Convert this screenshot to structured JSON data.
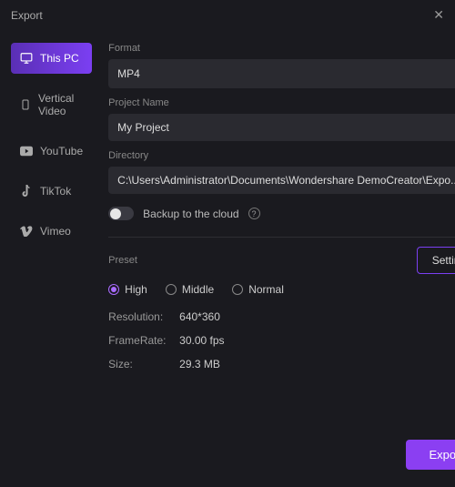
{
  "window": {
    "title": "Export"
  },
  "sidebar": {
    "items": [
      {
        "label": "This PC"
      },
      {
        "label": "Vertical Video"
      },
      {
        "label": "YouTube"
      },
      {
        "label": "TikTok"
      },
      {
        "label": "Vimeo"
      }
    ]
  },
  "main": {
    "format_label": "Format",
    "format_value": "MP4",
    "project_name_label": "Project Name",
    "project_name_value": "My Project",
    "directory_label": "Directory",
    "directory_value": "C:\\Users\\Administrator\\Documents\\Wondershare DemoCreator\\Expo...",
    "backup_label": "Backup to the cloud",
    "preset_label": "Preset",
    "settings_button": "Settings",
    "preset_options": [
      {
        "label": "High",
        "selected": true
      },
      {
        "label": "Middle",
        "selected": false
      },
      {
        "label": "Normal",
        "selected": false
      }
    ],
    "info": {
      "resolution_label": "Resolution:",
      "resolution_value": "640*360",
      "framerate_label": "FrameRate:",
      "framerate_value": "30.00 fps",
      "size_label": "Size:",
      "size_value": "29.3 MB"
    },
    "export_button": "Export"
  },
  "colors": {
    "accent": "#8b3ff2"
  }
}
